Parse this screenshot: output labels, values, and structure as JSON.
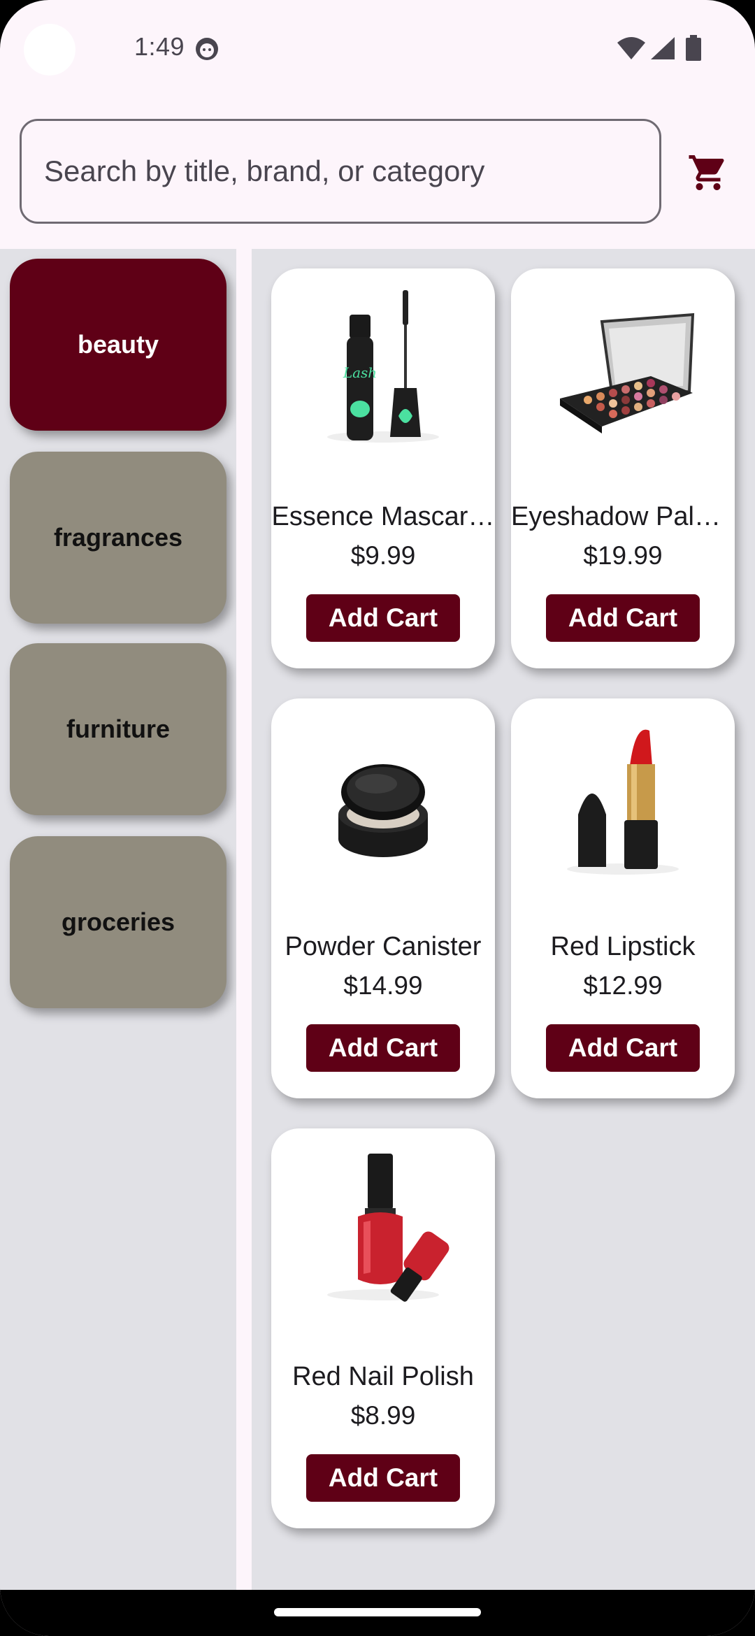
{
  "status_bar": {
    "time": "1:49"
  },
  "search": {
    "placeholder": "Search by title, brand, or category"
  },
  "categories": [
    {
      "label": "beauty",
      "active": true
    },
    {
      "label": "fragrances",
      "active": false
    },
    {
      "label": "furniture",
      "active": false
    },
    {
      "label": "groceries",
      "active": false
    }
  ],
  "products": [
    {
      "title": "Essence Mascar…",
      "price": "$9.99",
      "button": "Add Cart",
      "image": "mascara"
    },
    {
      "title": "Eyeshadow Pale…",
      "price": "$19.99",
      "button": "Add Cart",
      "image": "eyeshadow-palette"
    },
    {
      "title": "Powder Canister",
      "price": "$14.99",
      "button": "Add Cart",
      "image": "powder-canister"
    },
    {
      "title": "Red Lipstick",
      "price": "$12.99",
      "button": "Add Cart",
      "image": "lipstick"
    },
    {
      "title": "Red Nail Polish",
      "price": "$8.99",
      "button": "Add Cart",
      "image": "nail-polish"
    }
  ],
  "colors": {
    "accent": "#5f0016",
    "category_inactive": "#918c7e",
    "background": "#fdf5fb",
    "panel": "#e1e1e6"
  },
  "icons": {
    "cart": "shopping-cart-icon",
    "wifi": "wifi-icon",
    "signal": "cell-signal-icon",
    "battery": "battery-icon"
  }
}
